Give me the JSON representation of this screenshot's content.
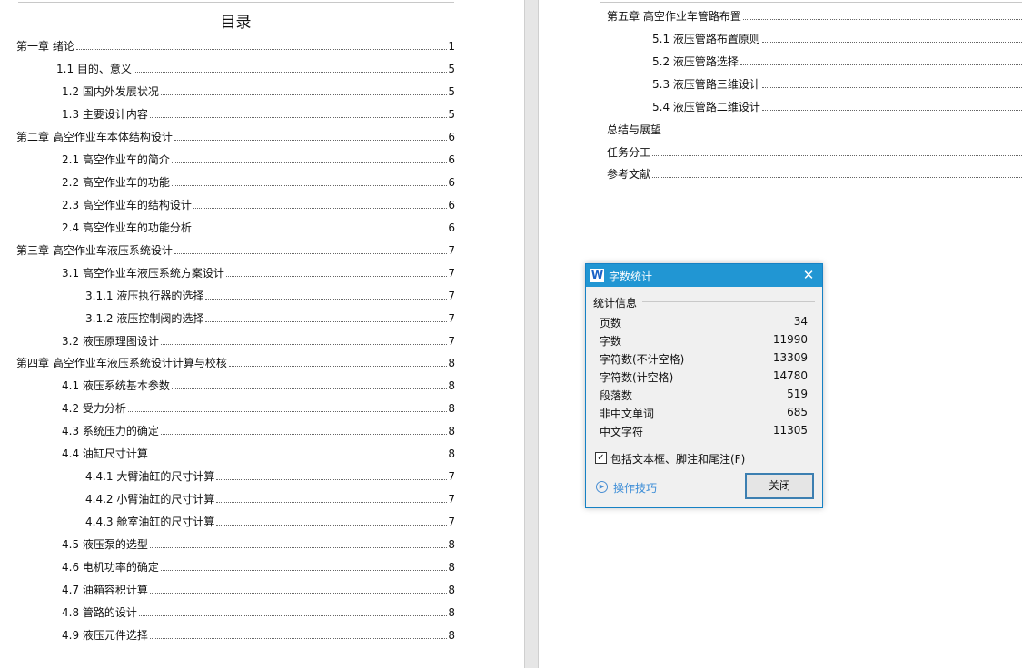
{
  "left_page": {
    "title": "目录",
    "entries": [
      {
        "text": "第一章 绪论",
        "page": "1"
      },
      {
        "text": "1.1 目的、意义",
        "page": "5"
      },
      {
        "text": "1.2 国内外发展状况",
        "page": "5"
      },
      {
        "text": "1.3 主要设计内容",
        "page": "5"
      },
      {
        "text": "第二章 高空作业车本体结构设计",
        "page": "6"
      },
      {
        "text": "2.1 高空作业车的简介",
        "page": "6"
      },
      {
        "text": "2.2 高空作业车的功能",
        "page": "6"
      },
      {
        "text": "2.3 高空作业车的结构设计",
        "page": "6"
      },
      {
        "text": "2.4 高空作业车的功能分析",
        "page": "6"
      },
      {
        "text": "第三章 高空作业车液压系统设计",
        "page": "7"
      },
      {
        "text": "3.1 高空作业车液压系统方案设计",
        "page": "7"
      },
      {
        "text": "3.1.1 液压执行器的选择",
        "page": "7"
      },
      {
        "text": "3.1.2 液压控制阀的选择",
        "page": "7"
      },
      {
        "text": "3.2 液压原理图设计",
        "page": "7"
      },
      {
        "text": "第四章 高空作业车液压系统设计计算与校核",
        "page": "8"
      },
      {
        "text": "4.1 液压系统基本参数",
        "page": "8"
      },
      {
        "text": "4.2 受力分析",
        "page": "8"
      },
      {
        "text": "4.3 系统压力的确定",
        "page": "8"
      },
      {
        "text": "4.4 油缸尺寸计算",
        "page": "8"
      },
      {
        "text": "4.4.1 大臂油缸的尺寸计算",
        "page": "7"
      },
      {
        "text": "4.4.2 小臂油缸的尺寸计算",
        "page": "7"
      },
      {
        "text": "4.4.3 舱室油缸的尺寸计算",
        "page": "7"
      },
      {
        "text": "4.5 液压泵的选型",
        "page": "8"
      },
      {
        "text": "4.6 电机功率的确定",
        "page": "8"
      },
      {
        "text": "4.7 油箱容积计算",
        "page": "8"
      },
      {
        "text": "4.8 管路的设计",
        "page": "8"
      },
      {
        "text": "4.9 液压元件选择",
        "page": "8"
      }
    ]
  },
  "right_page": {
    "entries": [
      {
        "text": "第五章 高空作业车管路布置"
      },
      {
        "text": "5.1 液压管路布置原则"
      },
      {
        "text": "5.2 液压管路选择"
      },
      {
        "text": "5.3 液压管路三维设计"
      },
      {
        "text": "5.4 液压管路二维设计"
      },
      {
        "text": "总结与展望"
      },
      {
        "text": "任务分工"
      },
      {
        "text": "参考文献"
      }
    ]
  },
  "dialog": {
    "app_icon": "W",
    "title": "字数统计",
    "close_icon": "✕",
    "group_label": "统计信息",
    "stats": [
      {
        "label": "页数",
        "value": "34"
      },
      {
        "label": "字数",
        "value": "11990"
      },
      {
        "label": "字符数(不计空格)",
        "value": "13309"
      },
      {
        "label": "字符数(计空格)",
        "value": "14780"
      },
      {
        "label": "段落数",
        "value": "519"
      },
      {
        "label": "非中文单词",
        "value": "685"
      },
      {
        "label": "中文字符",
        "value": "11305"
      }
    ],
    "checkbox_label": "包括文本框、脚注和尾注(F)",
    "checkbox_checked": true,
    "tips_label": "操作技巧",
    "close_button": "关闭",
    "accent_color": "#2196d3"
  }
}
